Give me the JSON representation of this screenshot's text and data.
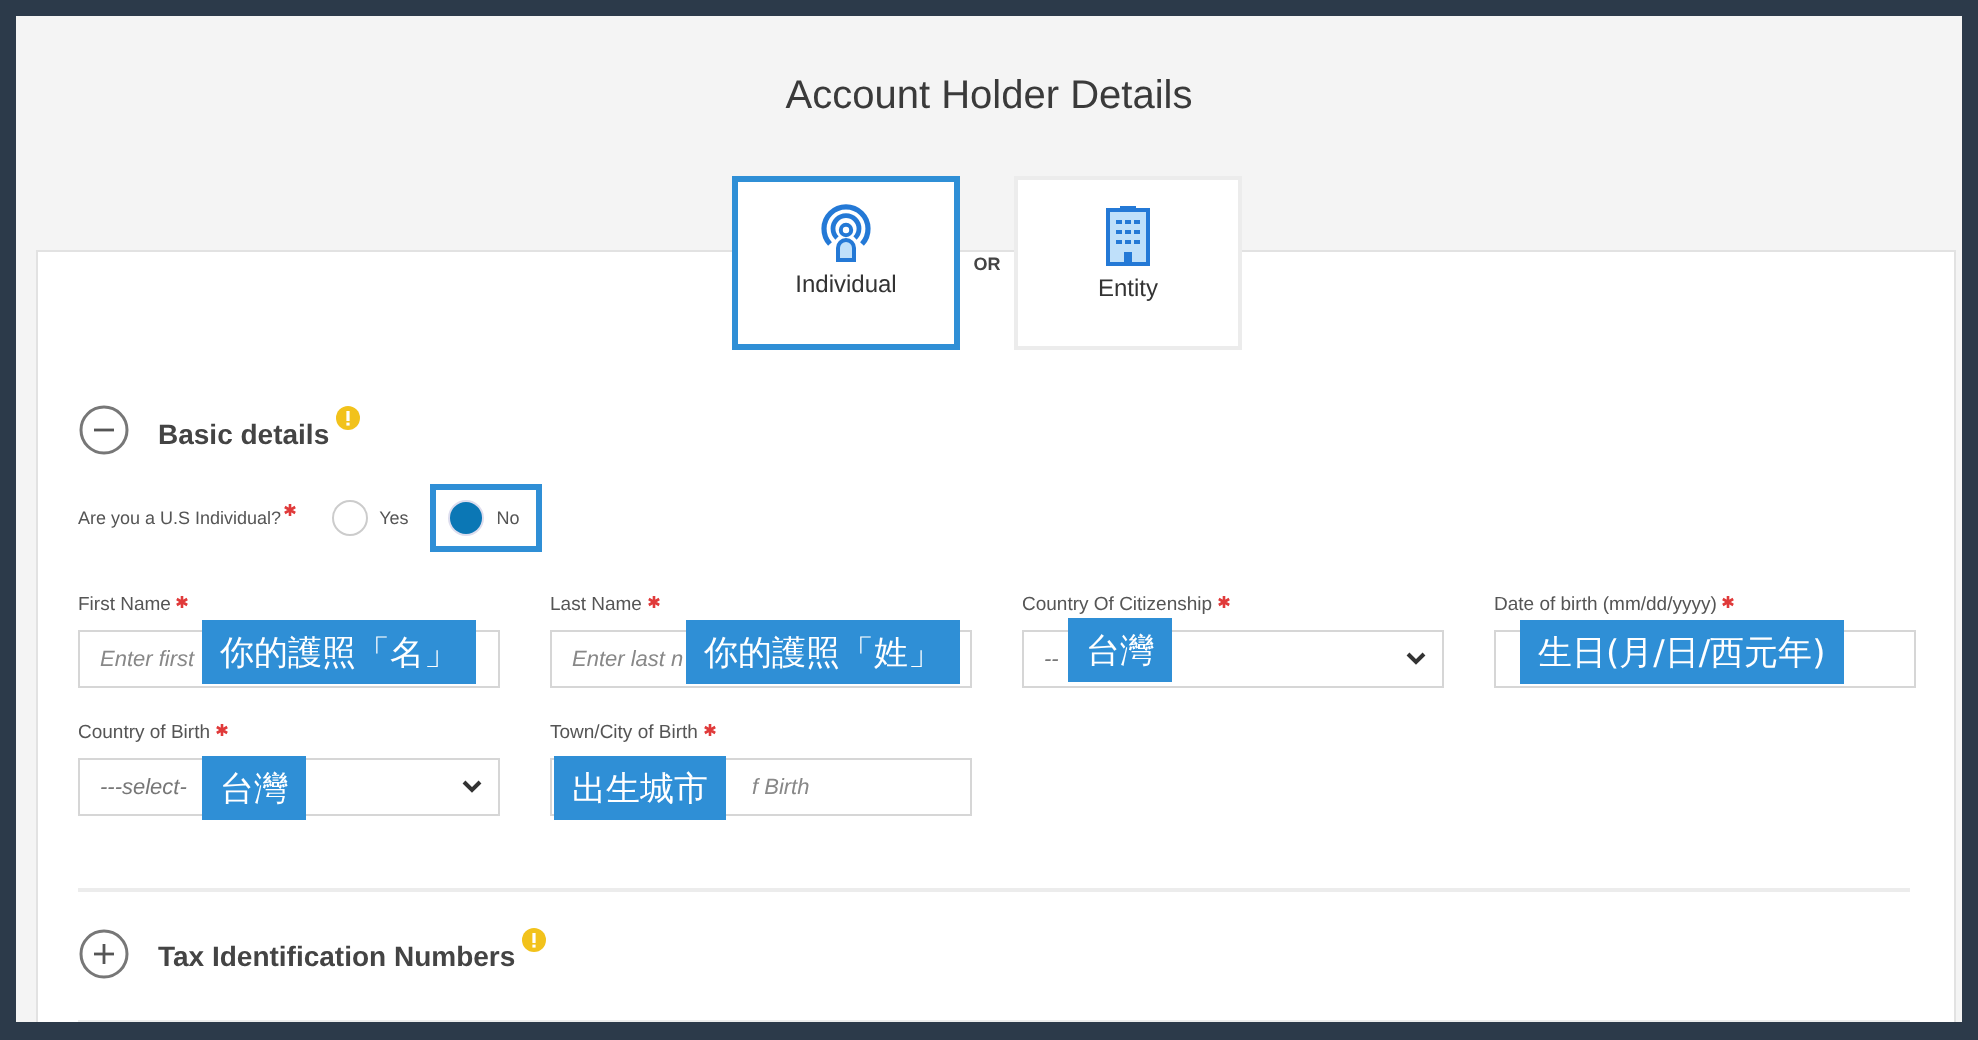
{
  "title": "Account Holder Details",
  "holder_types": [
    {
      "label": "Individual",
      "kind": "person",
      "selected": true
    },
    {
      "label": "Entity",
      "kind": "building",
      "selected": false
    }
  ],
  "separator": "OR",
  "basic_details": {
    "title": "Basic details",
    "expanded": true,
    "question": {
      "label": "Are you a U.S Individual?",
      "required": true,
      "options": [
        {
          "label": "Yes",
          "selected": false,
          "highlighted": false
        },
        {
          "label": "No",
          "selected": true,
          "highlighted": true
        }
      ]
    },
    "fields": [
      {
        "label": "First Name",
        "required": true,
        "kind": "text",
        "placeholder": "Enter first",
        "annotation": "你的護照「名」"
      },
      {
        "label": "Last Name",
        "required": true,
        "kind": "text",
        "placeholder": "Enter last n",
        "annotation": "你的護照「姓」"
      },
      {
        "label": "Country Of Citizenship",
        "required": true,
        "kind": "select",
        "value": "--",
        "annotation": "台灣"
      },
      {
        "label": "Date of birth (mm/dd/yyyy)",
        "required": true,
        "kind": "text",
        "annotation": "生日(月/日/西元年)"
      },
      {
        "label": "Country of Birth",
        "required": true,
        "kind": "select",
        "value": "---select-",
        "annotation": "台灣"
      },
      {
        "label": "Town/City of Birth",
        "required": true,
        "kind": "text",
        "placeholder": "f Birth",
        "annotation": "出生城市"
      }
    ]
  },
  "tax_section": {
    "title": "Tax Identification Numbers",
    "expanded": false
  }
}
